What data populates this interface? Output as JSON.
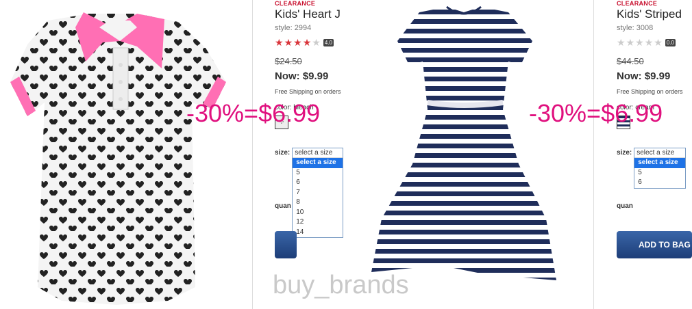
{
  "products": [
    {
      "clearance": "CLEARANCE",
      "title": "Kids' Heart J",
      "style": "style: 2994",
      "rating": 4,
      "rating_text": "4.0",
      "was_price": "$24.50",
      "now_price": "Now: $9.99",
      "shipping": "Free Shipping on orders",
      "color_label": "color: bleach",
      "size_label": "size:",
      "size_select_value": "select a size",
      "size_options": [
        "select a size",
        "5",
        "6",
        "7",
        "8",
        "10",
        "12",
        "14"
      ],
      "quantity_label": "quan",
      "promo": "-30%=$6.99",
      "star_color": "#d9343a"
    },
    {
      "clearance": "CLEARANCE",
      "title": "Kids' Striped",
      "style": "style: 3008",
      "rating": 0,
      "rating_text": "0.0",
      "was_price": "$44.50",
      "now_price": "Now: $9.99",
      "shipping": "Free Shipping on orders",
      "color_label": "color: cream",
      "size_label": "size:",
      "size_select_value": "select a size",
      "size_options": [
        "select a size",
        "5",
        "6"
      ],
      "quantity_label": "quan",
      "add_to_bag": "ADD TO BAG",
      "promo": "-30%=$6.99"
    }
  ],
  "watermark": "buy_brands",
  "colors": {
    "accent": "#e0107e",
    "brand_red": "#c8102e",
    "button": "#2a4f8f"
  }
}
